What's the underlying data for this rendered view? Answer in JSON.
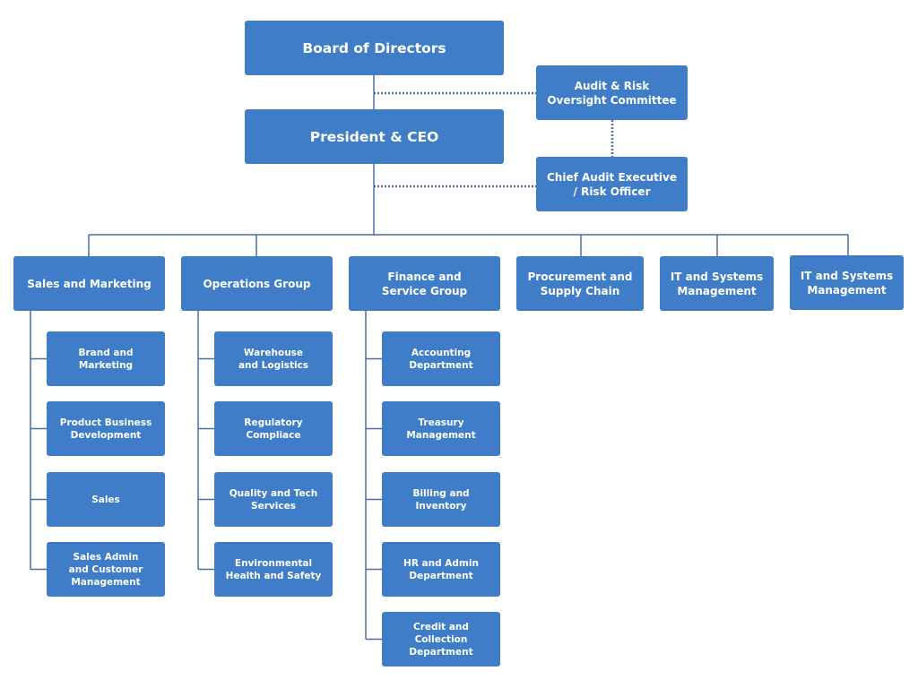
{
  "colors": {
    "box_fill": "#3f7dc8",
    "box_text": "#ffffff",
    "line": "#4a6ea3",
    "background": "#ffffff"
  },
  "chart": {
    "type": "org-chart",
    "top": [
      {
        "id": "board",
        "label": "Board of Directors"
      },
      {
        "id": "ceo",
        "label": "President & CEO"
      }
    ],
    "advisory": [
      {
        "id": "audit",
        "label": "Audit & Risk\nOversight Committee",
        "dotted_link_to": "board"
      },
      {
        "id": "cae",
        "label": "Chief Audit Executive\n/ Risk Officer",
        "dotted_link_to": "ceo"
      }
    ],
    "divisions": [
      {
        "id": "sales-marketing",
        "label": "Sales and Marketing",
        "children": [
          "Brand and\nMarketing",
          "Product Business\nDevelopment",
          "Sales",
          "Sales Admin\nand Customer\nManagement"
        ]
      },
      {
        "id": "operations",
        "label": "Operations Group",
        "children": [
          "Warehouse\nand Logistics",
          "Regulatory\nCompliace",
          "Quality and Tech\nServices",
          "Environmental\nHealth and Safety"
        ]
      },
      {
        "id": "finance",
        "label": "Finance and\nService Group",
        "children": [
          "Accounting\nDepartment",
          "Treasury\nManagement",
          "Billing and\nInventory",
          "HR and Admin\nDepartment",
          "Credit and\nCollection\nDepartment"
        ]
      },
      {
        "id": "procurement",
        "label": "Procurement and\nSupply Chain",
        "children": []
      },
      {
        "id": "it-1",
        "label": "IT and Systems\nManagement",
        "children": []
      },
      {
        "id": "it-2",
        "label": "IT and Systems\nManagement",
        "children": []
      }
    ]
  }
}
